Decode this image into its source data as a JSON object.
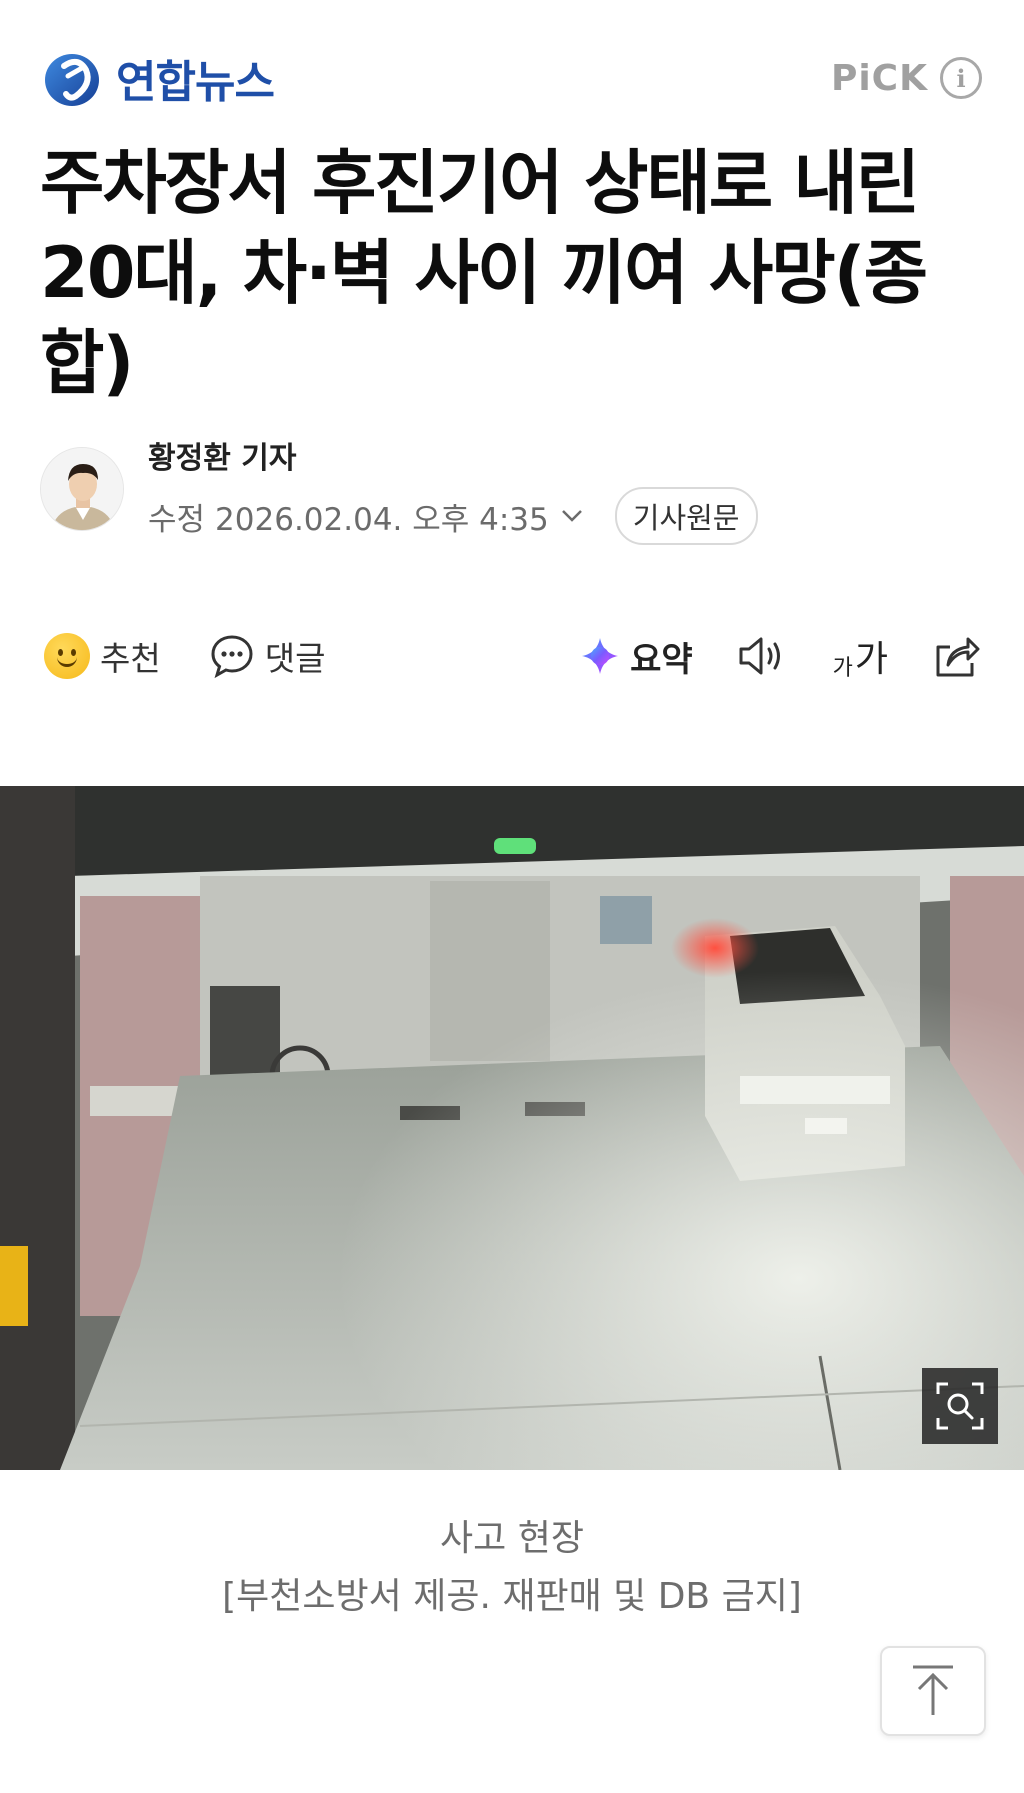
{
  "header": {
    "logo_text": "연합뉴스",
    "logo_icon": "yonhap-logo-icon",
    "pick_label": "PiCK",
    "info_icon": "info-icon"
  },
  "article": {
    "title": "주차장서 후진기어 상태로 내린 20대, 차·벽 사이 끼여 사망(종합)",
    "author_name": "황정환 기자",
    "edited_label": "수정",
    "datetime": "2026.02.04. 오후 4:35",
    "original_button": "기사원문"
  },
  "actions": {
    "recommend_label": "추천",
    "comment_label": "댓글",
    "summary_label": "요약",
    "font_small": "가",
    "font_big": "가",
    "icons": [
      "smile-icon",
      "comment-icon",
      "ai-summary-icon",
      "speaker-icon",
      "font-size-icon",
      "share-icon"
    ]
  },
  "photo": {
    "caption_line1": "사고 현장",
    "caption_line2": "[부천소방서 제공. 재판매 및 DB 금지]",
    "zoom_icon": "zoom-icon"
  },
  "colors": {
    "brand_blue": "#1f4fa8",
    "text_dark": "#0d0d0d",
    "text_gray": "#6b6b6b",
    "pick_gray": "#a0a0a0"
  }
}
